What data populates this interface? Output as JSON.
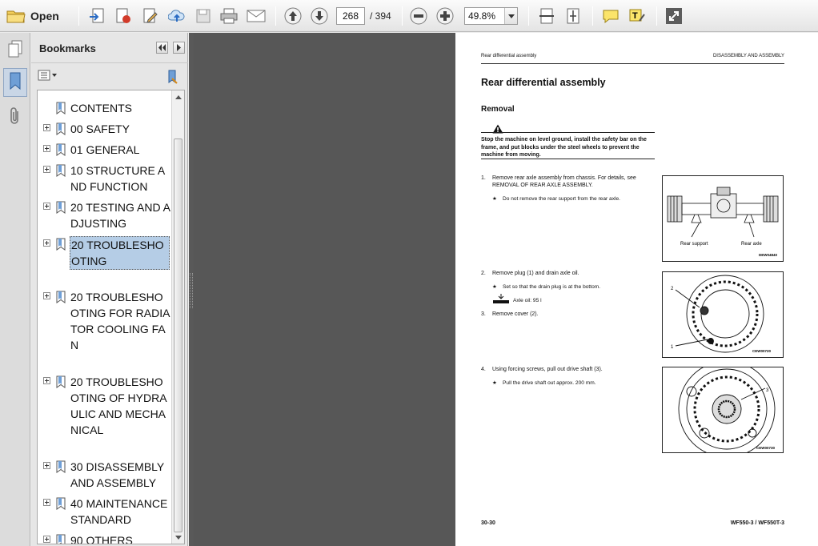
{
  "toolbar": {
    "open_label": "Open",
    "current_page": "268",
    "page_total": "/ 394",
    "zoom": "49.8%"
  },
  "bookmarks": {
    "title": "Bookmarks",
    "items": [
      {
        "label": "CONTENTS",
        "expandable": false,
        "selected": false
      },
      {
        "label": "00 SAFETY",
        "expandable": true,
        "selected": false
      },
      {
        "label": "01 GENERAL",
        "expandable": true,
        "selected": false
      },
      {
        "label": "10 STRUCTURE AND FUNCTION",
        "expandable": true,
        "selected": false
      },
      {
        "label": "20 TESTING AND ADJUSTING",
        "expandable": true,
        "selected": false
      },
      {
        "label": "20 TROUBLESHOOTING",
        "expandable": true,
        "selected": true
      },
      {
        "label": "20 TROUBLESHOOTING FOR RADIATOR COOLING FAN",
        "expandable": true,
        "selected": false
      },
      {
        "label": "20 TROUBLESHOOTING OF HYDRAULIC AND MECHANICAL",
        "expandable": true,
        "selected": false
      },
      {
        "label": "30 DISASSEMBLY AND ASSEMBLY",
        "expandable": true,
        "selected": false
      },
      {
        "label": "40 MAINTENANCE STANDARD",
        "expandable": true,
        "selected": false
      },
      {
        "label": "90 OTHERS",
        "expandable": true,
        "selected": false
      }
    ]
  },
  "document": {
    "header_left": "Rear differential assembly",
    "header_right": "DISASSEMBLY AND ASSEMBLY",
    "title": "Rear differential assembly",
    "section": "Removal",
    "warning": "Stop the machine on level ground, install the safety bar on the frame, and put blocks under the steel wheels to prevent the machine from moving.",
    "steps": [
      {
        "num": "1.",
        "text": "Remove rear axle assembly from chassis. For details, see REMOVAL OF REAR AXLE ASSEMBLY.",
        "note": "Do not remove the rear support from the rear axle."
      },
      {
        "num": "2.",
        "text": "Remove plug (1) and drain axle oil.",
        "note": "Set so that the drain plug is at the bottom.",
        "oil": "Axle oil: 95 l"
      },
      {
        "num": "3.",
        "text": "Remove cover (2)."
      },
      {
        "num": "4.",
        "text": "Using forcing screws, pull out drive shaft (3).",
        "note": "Pull the drive shaft out approx. 200 mm."
      }
    ],
    "figures": [
      {
        "code": "DEW04840",
        "labels": [
          "Rear support",
          "Rear axle"
        ]
      },
      {
        "code": "CEW00720",
        "labels": [
          "2",
          "1"
        ]
      },
      {
        "code": "CEW00730",
        "labels": [
          "3"
        ]
      }
    ],
    "footer_left": "30-30",
    "footer_right": "WF550-3 / WF550T-3"
  }
}
